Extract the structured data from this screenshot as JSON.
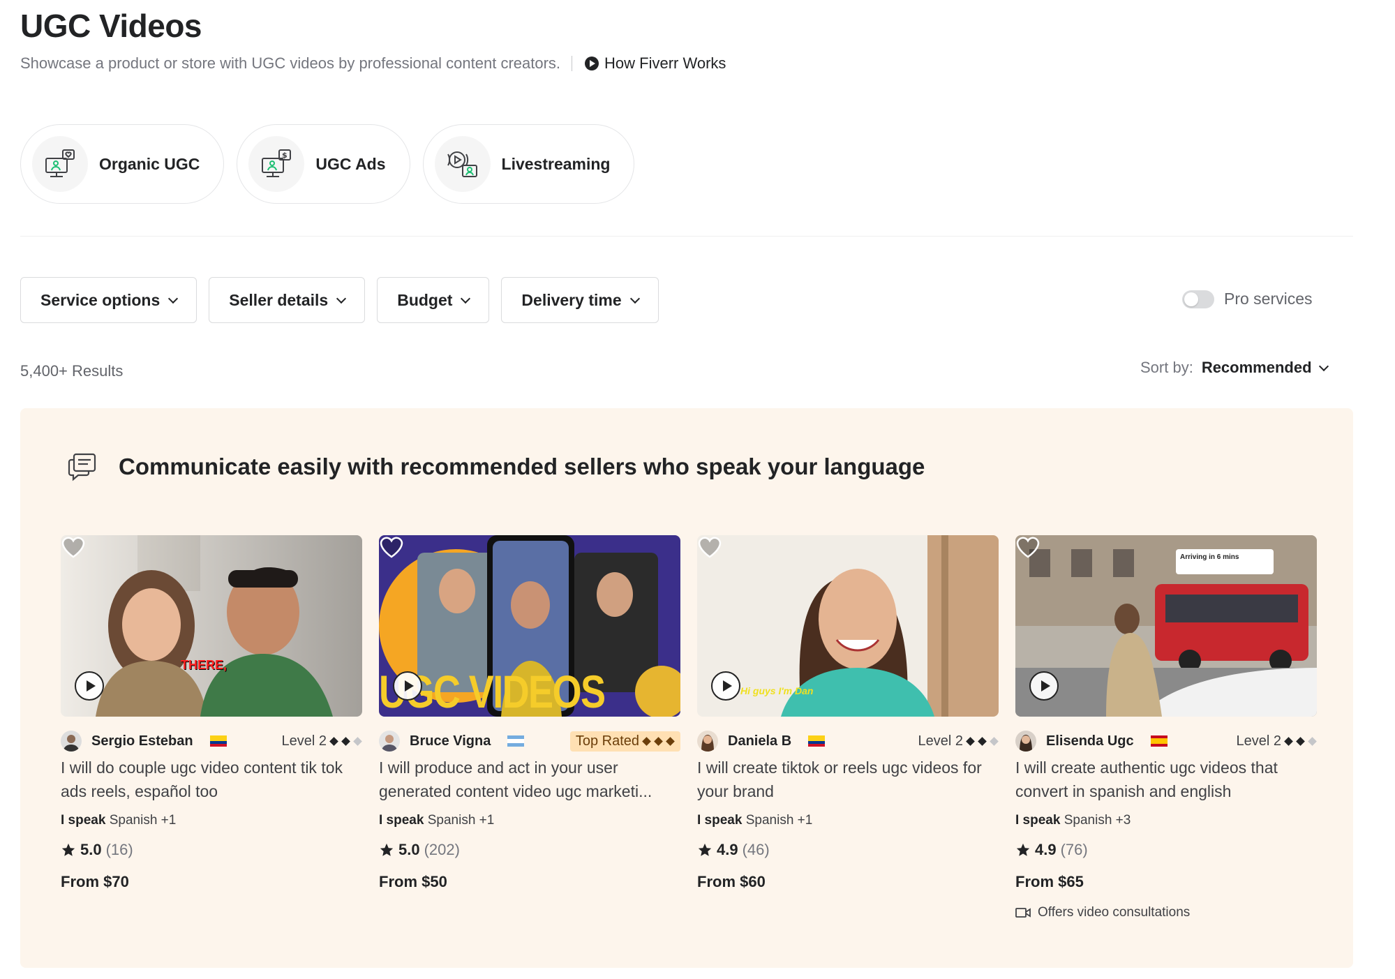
{
  "header": {
    "title": "UGC Videos",
    "subtitle": "Showcase a product or store with UGC videos by professional content creators.",
    "how_link": "How Fiverr Works"
  },
  "subcategories": [
    {
      "label": "Organic UGC",
      "icon": "monitor-heart-icon"
    },
    {
      "label": "UGC Ads",
      "icon": "monitor-dollar-icon"
    },
    {
      "label": "Livestreaming",
      "icon": "livestream-icon"
    }
  ],
  "filters": [
    {
      "label": "Service options"
    },
    {
      "label": "Seller details"
    },
    {
      "label": "Budget"
    },
    {
      "label": "Delivery time"
    }
  ],
  "pro_services": {
    "label": "Pro services",
    "enabled": false
  },
  "results": {
    "count": "5,400+ Results"
  },
  "sort": {
    "label": "Sort by:",
    "value": "Recommended"
  },
  "panel": {
    "title": "Communicate easily with recommended sellers who speak your language"
  },
  "cards": [
    {
      "seller": "Sergio Esteban",
      "badge": "Level 2",
      "title": "I will do couple ugc video content tik tok ads reels, español too",
      "speak_label": "I speak",
      "languages": "Spanish +1",
      "rating": "5.0",
      "reviews": "(16)",
      "price": "From $70",
      "caption": "THERE,",
      "flag": "colombia-flag-icon"
    },
    {
      "seller": "Bruce Vigna",
      "badge": "Top Rated",
      "title": "I will produce and act in your user generated content video ugc marketi...",
      "speak_label": "I speak",
      "languages": "Spanish +1",
      "rating": "5.0",
      "reviews": "(202)",
      "price": "From $50",
      "caption": "UGC VIDEOS",
      "flag": "argentina-flag-icon"
    },
    {
      "seller": "Daniela B",
      "badge": "Level 2",
      "title": "I will create tiktok or reels ugc videos for your brand",
      "speak_label": "I speak",
      "languages": "Spanish +1",
      "rating": "4.9",
      "reviews": "(46)",
      "price": "From $60",
      "caption": "Hi guys I'm Dan",
      "flag": "colombia-flag-icon"
    },
    {
      "seller": "Elisenda Ugc",
      "badge": "Level 2",
      "title": "I will create authentic ugc videos that convert in spanish and english",
      "speak_label": "I speak",
      "languages": "Spanish +3",
      "rating": "4.9",
      "reviews": "(76)",
      "price": "From $65",
      "extra": "Offers video consultations",
      "caption": "Arriving in 6 mins",
      "flag": "spain-flag-icon"
    }
  ],
  "colors": {
    "panel_bg": "#fdf5ec",
    "top_rated_bg": "#ffe0b3",
    "text": "#222325"
  }
}
